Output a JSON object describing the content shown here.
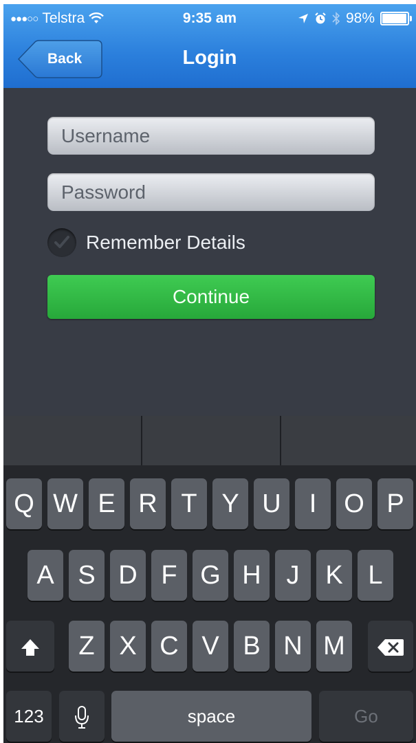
{
  "status_bar": {
    "carrier": "Telstra",
    "time": "9:35 am",
    "battery": "98%",
    "battery_level": 0.98,
    "icons": [
      "signal-dots-icon",
      "wifi-icon",
      "location-icon",
      "alarm-icon",
      "bluetooth-icon",
      "battery-icon"
    ]
  },
  "nav": {
    "back_label": "Back",
    "title": "Login"
  },
  "form": {
    "username_placeholder": "Username",
    "username_value": "",
    "password_placeholder": "Password",
    "password_value": "",
    "remember_label": "Remember Details",
    "remember_checked": true,
    "continue_label": "Continue"
  },
  "keyboard": {
    "row1": [
      "Q",
      "W",
      "E",
      "R",
      "T",
      "Y",
      "U",
      "I",
      "O",
      "P"
    ],
    "row2": [
      "A",
      "S",
      "D",
      "F",
      "G",
      "H",
      "J",
      "K",
      "L"
    ],
    "row3": [
      "Z",
      "X",
      "C",
      "V",
      "B",
      "N",
      "M"
    ],
    "numbers_label": "123",
    "space_label": "space",
    "go_label": "Go"
  },
  "colors": {
    "nav_blue": "#2b7fdc",
    "continue_green": "#33b847",
    "background": "#383c45",
    "key": "#5b5f66"
  }
}
